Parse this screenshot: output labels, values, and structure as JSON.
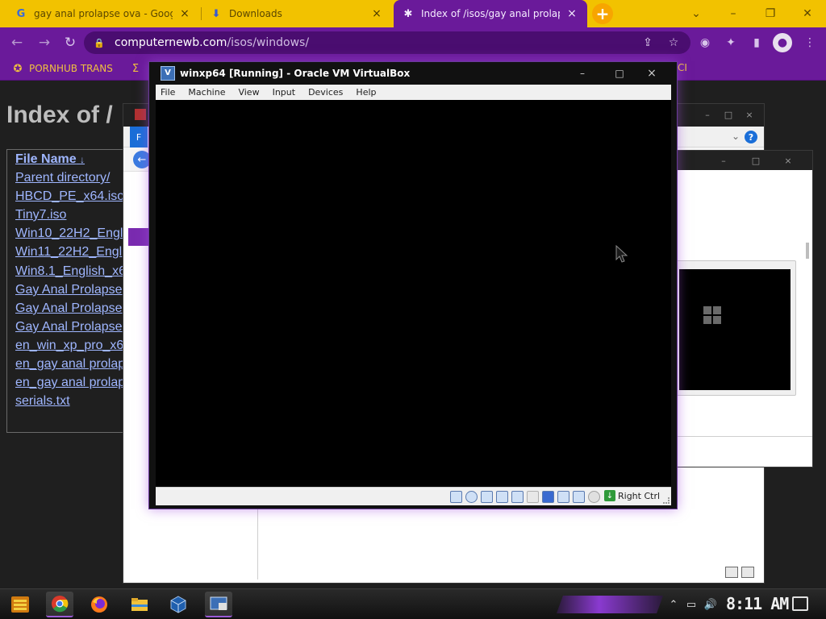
{
  "browser": {
    "tabs": [
      {
        "label": "gay anal prolapse ova - Google S",
        "icon": "google-g-icon",
        "active": false
      },
      {
        "label": "Downloads",
        "icon": "download-icon",
        "active": false
      },
      {
        "label": "Index of /isos/gay anal prolapse",
        "icon": "site-icon",
        "active": true
      }
    ],
    "new_tab": "+",
    "address": {
      "host": "computernewb.com",
      "path": "/isos/windows/"
    },
    "bookmarks": [
      {
        "label": "PORNHUB TRANS",
        "icon": "bookmark-site-icon"
      }
    ],
    "bookmark_partial": "CI"
  },
  "page": {
    "title": "Index of /",
    "file_header": "File Name",
    "sort_indicator": "↓",
    "files": [
      "Parent directory/",
      "HBCD_PE_x64.iso",
      "Tiny7.iso",
      "Win10_22H2_Engl",
      "Win11_22H2_Engl",
      "Win8.1_English_x6",
      "Gay Anal Prolapse",
      "Gay Anal Prolapse",
      "Gay Anal Prolapse",
      "en_win_xp_pro_x6",
      "en_gay anal prolap",
      "en_gay anal prolap",
      "serials.txt"
    ]
  },
  "bg_window": {
    "ribbon_tab": "F",
    "help": "?"
  },
  "virtualbox": {
    "title": "winxp64 [Running] - Oracle VM VirtualBox",
    "menu": [
      "File",
      "Machine",
      "View",
      "Input",
      "Devices",
      "Help"
    ],
    "host_key": "Right Ctrl",
    "controls": {
      "minimize": "–",
      "maximize": "□",
      "close": "×"
    }
  },
  "taskbar": {
    "clock": "8:11 AM",
    "apps": [
      {
        "name": "chrome",
        "running": true
      },
      {
        "name": "firefox",
        "running": false
      },
      {
        "name": "file-explorer",
        "running": false
      },
      {
        "name": "virtualbox-manager",
        "running": false
      },
      {
        "name": "virtualbox-vm",
        "running": true
      }
    ]
  },
  "colors": {
    "tab_strip": "#f2c200",
    "chrome_purple": "#6a1a9a",
    "link": "#9fb6ff"
  }
}
